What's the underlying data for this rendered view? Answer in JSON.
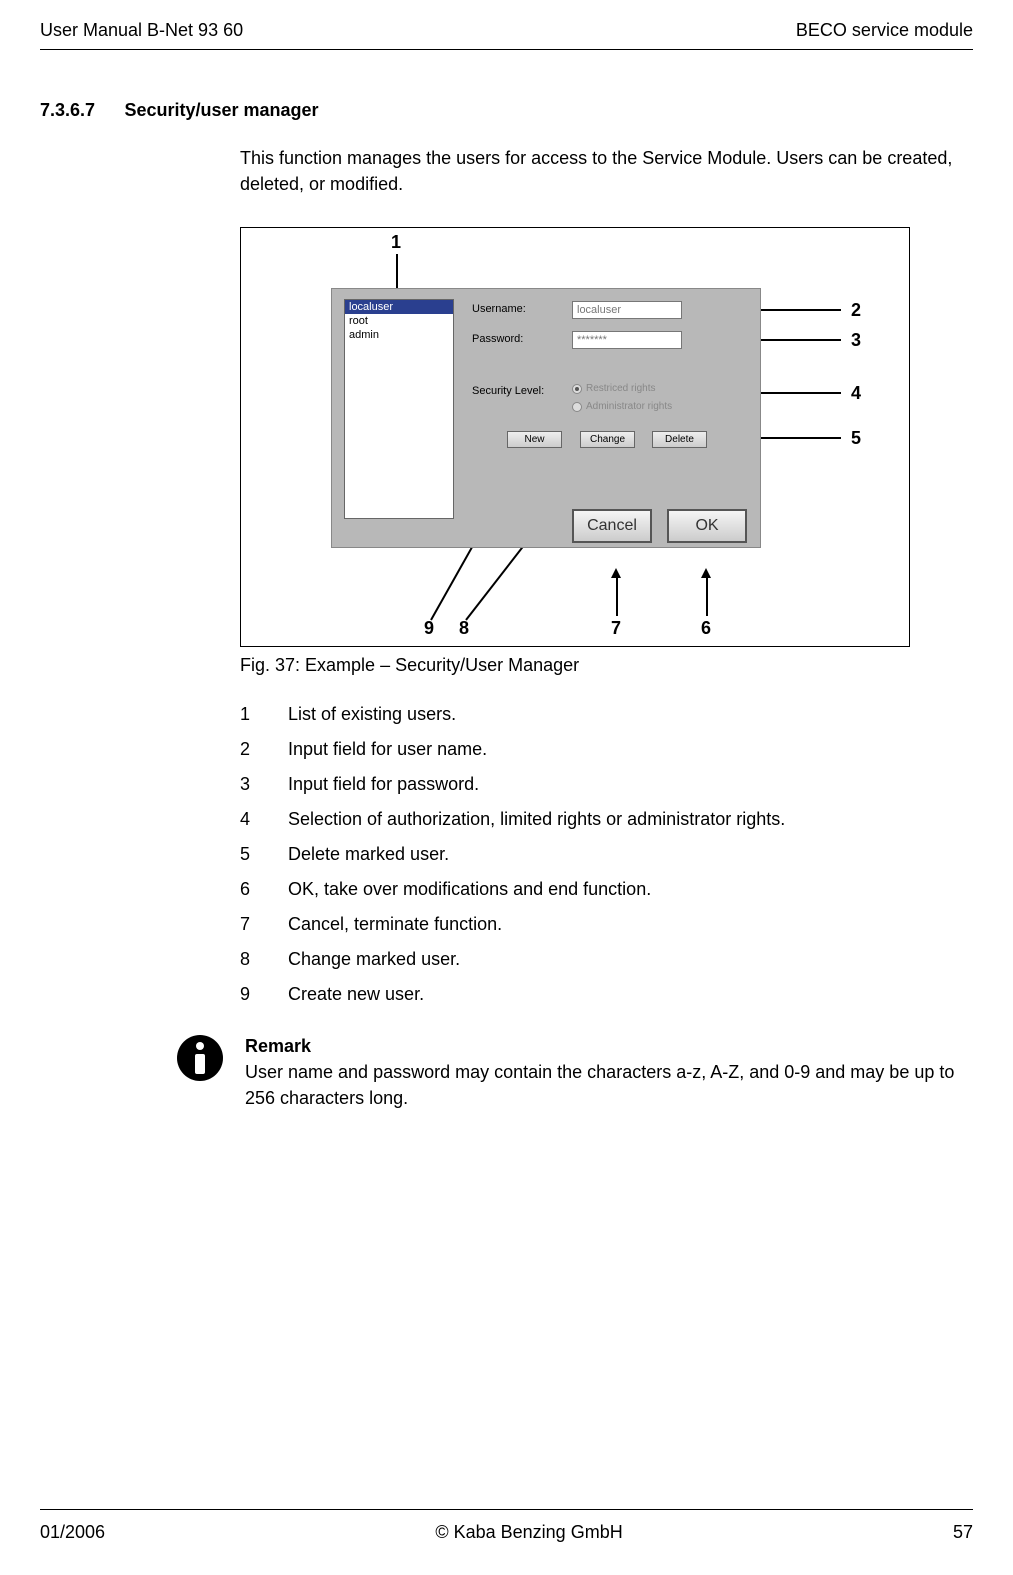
{
  "header": {
    "left": "User Manual B-Net 93 60",
    "right": "BECO service module"
  },
  "section": {
    "number": "7.3.6.7",
    "title": "Security/user manager"
  },
  "intro": "This function manages the users for access to the Service Module. Users can be created, deleted, or modified.",
  "figure": {
    "callouts": {
      "c1": "1",
      "c2": "2",
      "c3": "3",
      "c4": "4",
      "c5": "5",
      "c6": "6",
      "c7": "7",
      "c8": "8",
      "c9": "9"
    },
    "dialog": {
      "users": [
        "localuser",
        "root",
        "admin"
      ],
      "labels": {
        "username": "Username:",
        "password": "Password:",
        "seclevel": "Security Level:"
      },
      "fields": {
        "username": "localuser",
        "password": "*******"
      },
      "radio": {
        "restricted": "Restriced rights",
        "admin": "Administrator rights"
      },
      "buttons": {
        "new": "New",
        "change": "Change",
        "delete": "Delete",
        "cancel": "Cancel",
        "ok": "OK"
      }
    },
    "caption": "Fig. 37: Example – Security/User Manager"
  },
  "list": [
    {
      "n": "1",
      "t": "List of existing users."
    },
    {
      "n": "2",
      "t": "Input field for user name."
    },
    {
      "n": "3",
      "t": "Input field for password."
    },
    {
      "n": "4",
      "t": "Selection of authorization, limited rights or administrator rights."
    },
    {
      "n": "5",
      "t": "Delete marked user."
    },
    {
      "n": "6",
      "t": "OK, take over modifications and end function."
    },
    {
      "n": "7",
      "t": "Cancel, terminate function."
    },
    {
      "n": "8",
      "t": "Change marked user."
    },
    {
      "n": "9",
      "t": "Create new user."
    }
  ],
  "remark": {
    "heading": "Remark",
    "body": "User name and password may contain the characters a-z, A-Z, and 0-9 and may be up to 256 characters long."
  },
  "footer": {
    "left": "01/2006",
    "center": "© Kaba Benzing GmbH",
    "right": "57"
  }
}
